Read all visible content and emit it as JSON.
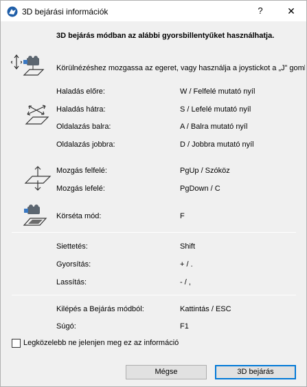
{
  "window": {
    "title": "3D bejárási információk",
    "help_label": "?",
    "close_label": "✕"
  },
  "intro": "3D bejárás módban az alábbi gyorsbillentyűket használhatja.",
  "look_description": "Körülnézéshez mozgassa az egeret, vagy használja a joystickot a „J” gombbal.",
  "movement": [
    {
      "label": "Haladás előre:",
      "key": "W / Felfelé mutató nyíl"
    },
    {
      "label": "Haladás hátra:",
      "key": "S / Lefelé mutató nyíl"
    },
    {
      "label": "Oldalazás balra:",
      "key": "A / Balra mutató nyíl"
    },
    {
      "label": "Oldalazás jobbra:",
      "key": "D / Jobbra mutató nyíl"
    }
  ],
  "vertical": [
    {
      "label": "Mozgás felfelé:",
      "key": "PgUp / Szóköz"
    },
    {
      "label": "Mozgás lefelé:",
      "key": "PgDown / C"
    }
  ],
  "tour": {
    "label": "Körséta mód:",
    "key": "F"
  },
  "speed": [
    {
      "label": "Siettetés:",
      "key": "Shift"
    },
    {
      "label": "Gyorsítás:",
      "key": "+ / ."
    },
    {
      "label": "Lassítás:",
      "key": "- / ,"
    }
  ],
  "misc": [
    {
      "label": "Kilépés a Bejárás módból:",
      "key": "Kattintás / ESC"
    },
    {
      "label": "Súgó:",
      "key": "F1"
    }
  ],
  "checkbox": {
    "label": "Legközelebb ne jelenjen meg ez az információ",
    "checked": false
  },
  "buttons": {
    "cancel": "Mégse",
    "ok": "3D bejárás"
  },
  "colors": {
    "accent": "#0078d7",
    "icon_blue": "#3a78c2"
  }
}
